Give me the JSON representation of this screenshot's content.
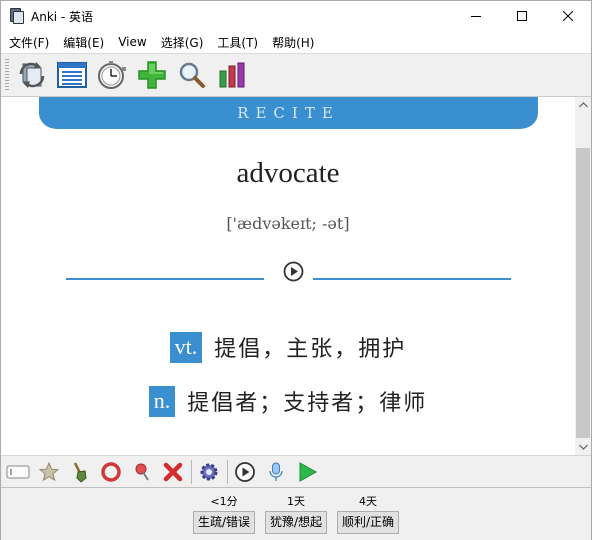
{
  "window": {
    "title": "Anki - 英语"
  },
  "menu": [
    "文件(F)",
    "编辑(E)",
    "View",
    "选择(G)",
    "工具(T)",
    "帮助(H)"
  ],
  "toolbar_icons": [
    "sync-icon",
    "browse-icon",
    "stopwatch-icon",
    "add-icon",
    "search-icon",
    "stats-icon"
  ],
  "card": {
    "header": "RECITE",
    "word": "advocate",
    "phonetic": "['ædvəkeɪt; -ət]",
    "definitions": [
      {
        "pos": "vt.",
        "text": "提倡，主张，拥护"
      },
      {
        "pos": "n.",
        "text": "提倡者；支持者；律师"
      }
    ]
  },
  "answers": [
    {
      "time": "<1分",
      "label": "生疏/错误"
    },
    {
      "time": "1天",
      "label": "犹豫/想起"
    },
    {
      "time": "4天",
      "label": "顺利/正确"
    }
  ],
  "colors": {
    "accent": "#3a8fd0",
    "play_green": "#2db84a"
  }
}
